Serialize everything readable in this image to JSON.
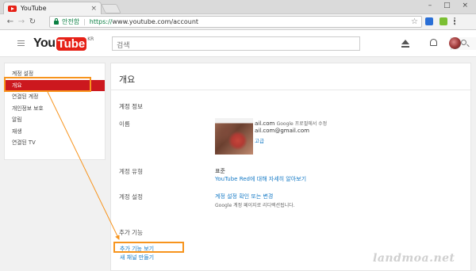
{
  "browser": {
    "tab_title": "YouTube",
    "tab_close": "×",
    "window_controls": "– □ ×",
    "secure_label": "안전함",
    "url_scheme": "https://",
    "url_rest": "www.youtube.com/account"
  },
  "header": {
    "logo_you": "You",
    "logo_tube": "Tube",
    "logo_region": "KR",
    "search_placeholder": "검색"
  },
  "sidebar": {
    "items": [
      {
        "label": "계정 설정",
        "active": false
      },
      {
        "label": "개요",
        "active": true
      },
      {
        "label": "연결된 계정",
        "active": false
      },
      {
        "label": "개인정보 보호",
        "active": false
      },
      {
        "label": "알림",
        "active": false
      },
      {
        "label": "재생",
        "active": false
      },
      {
        "label": "연결된 TV",
        "active": false
      }
    ]
  },
  "main": {
    "title": "개요",
    "account_info": {
      "heading": "계정 정보",
      "name_label": "이름",
      "email_primary": "ail.com",
      "edit_in_google": "Google 프로필에서 수정",
      "email_secondary": "ail.com@gmail.com",
      "advanced": "고급"
    },
    "account_type": {
      "label": "계정 유형",
      "value": "표준",
      "link": "YouTube Red에 대해 자세히 알아보기"
    },
    "account_settings": {
      "label": "계정 설정",
      "link": "계정 설정 확인 또는 변경",
      "note": "Google 계정 페이지로 리디렉션됩니다."
    },
    "additional": {
      "heading": "추가 기능",
      "view_link": "추가 기능 보기",
      "new_channel_link": "새 채널 만들기"
    }
  },
  "watermark": "landmoa.net",
  "colors": {
    "youtube_red": "#e62117",
    "active_red": "#cc181e",
    "link_blue": "#167ac6",
    "highlight_orange": "#f7941d",
    "secure_green": "#0b8043"
  }
}
